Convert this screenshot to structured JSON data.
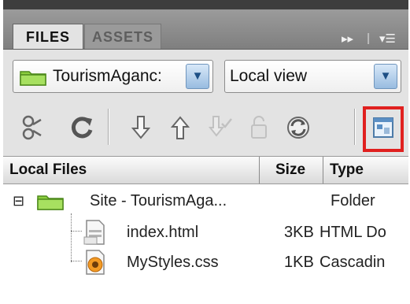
{
  "tabs": [
    {
      "label": "FILES",
      "active": true
    },
    {
      "label": "ASSETS",
      "active": false
    }
  ],
  "tabbar_icons": {
    "collapse": "fast-forward-icon",
    "options": "panel-options-menu-icon"
  },
  "site_select": {
    "value": "TourismAganc:",
    "icon": "folder-icon"
  },
  "view_select": {
    "value": "Local view"
  },
  "toolbar": [
    {
      "name": "connect-icon",
      "enabled": true
    },
    {
      "name": "refresh-icon",
      "enabled": true
    },
    {
      "name": "get-files-icon",
      "enabled": true
    },
    {
      "name": "put-files-icon",
      "enabled": true
    },
    {
      "name": "check-out-icon",
      "enabled": false
    },
    {
      "name": "check-in-icon",
      "enabled": false
    },
    {
      "name": "synchronize-icon",
      "enabled": true
    },
    {
      "name": "expand-show-site-icon",
      "enabled": true,
      "highlighted": true
    }
  ],
  "highlight_color": "#e0201f",
  "columns": {
    "name": "Local Files",
    "size": "Size",
    "type": "Type"
  },
  "rows": [
    {
      "name": "Site - TourismAga...",
      "size": "",
      "type": "Folder",
      "expander": "⊟"
    },
    {
      "name": "index.html",
      "size": "3KB",
      "type": "HTML Do"
    },
    {
      "name": "MyStyles.css",
      "size": "1KB",
      "type": "Cascadin"
    }
  ]
}
